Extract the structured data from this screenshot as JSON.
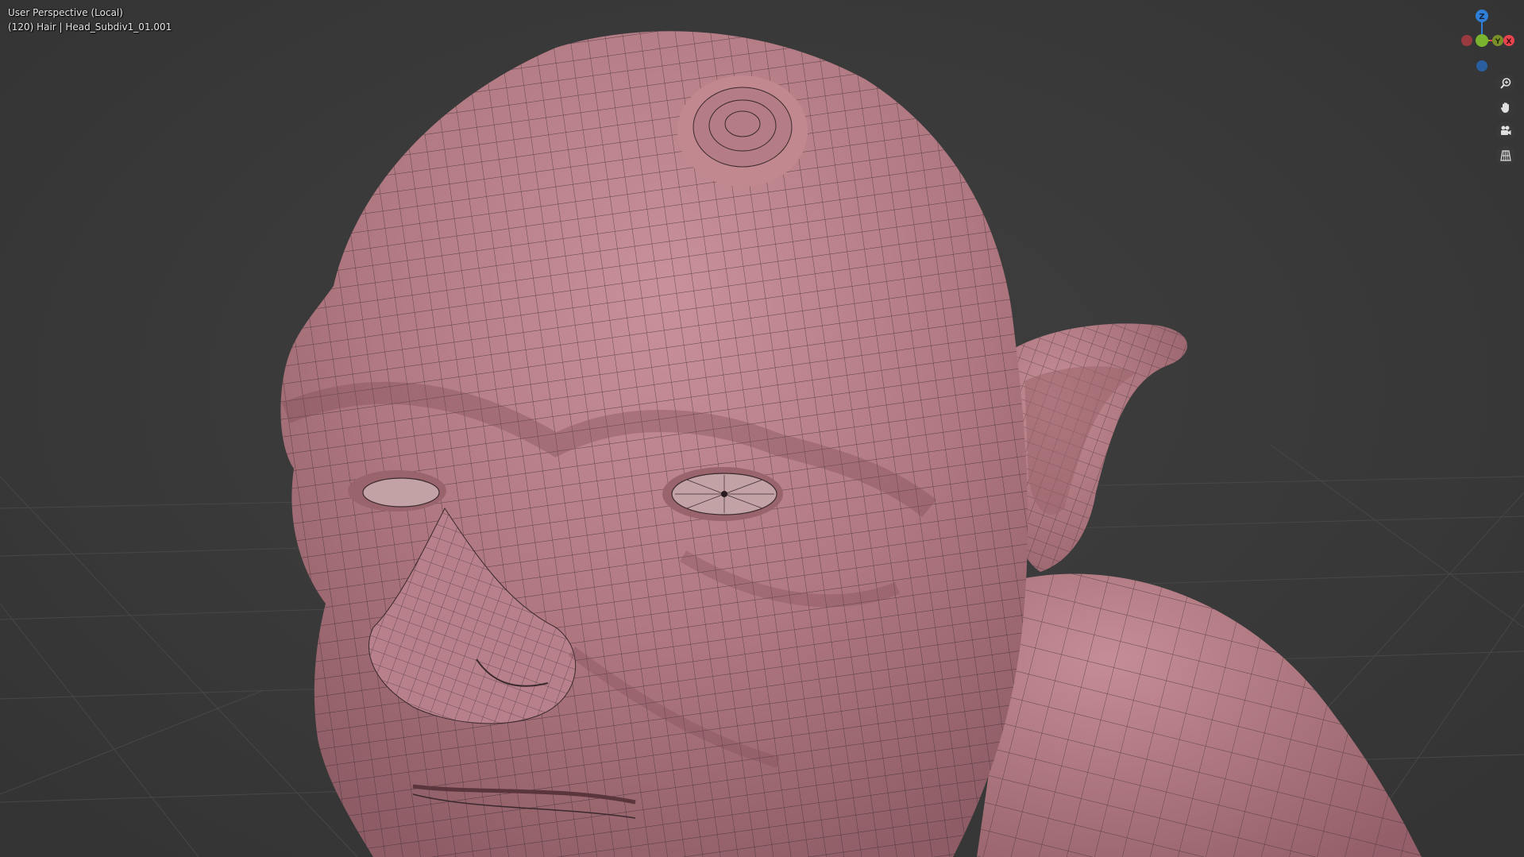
{
  "viewport": {
    "view_label": "User Perspective (Local)",
    "object_label": "(120) Hair | Head_Subdiv1_01.001"
  },
  "gizmo": {
    "z_label": "Z",
    "y_label": "Y",
    "x_label": "X",
    "colors": {
      "x_axis": "#e8444e",
      "y_axis": "#7ab32e",
      "z_axis": "#2f7fd8"
    }
  },
  "navigation": {
    "zoom_icon": "zoom-icon",
    "pan_icon": "hand-icon",
    "camera_icon": "camera-icon",
    "ortho_icon": "grid-icon"
  },
  "model": {
    "base_color": "#b57c84",
    "wire_color": "#3a2a2d"
  }
}
